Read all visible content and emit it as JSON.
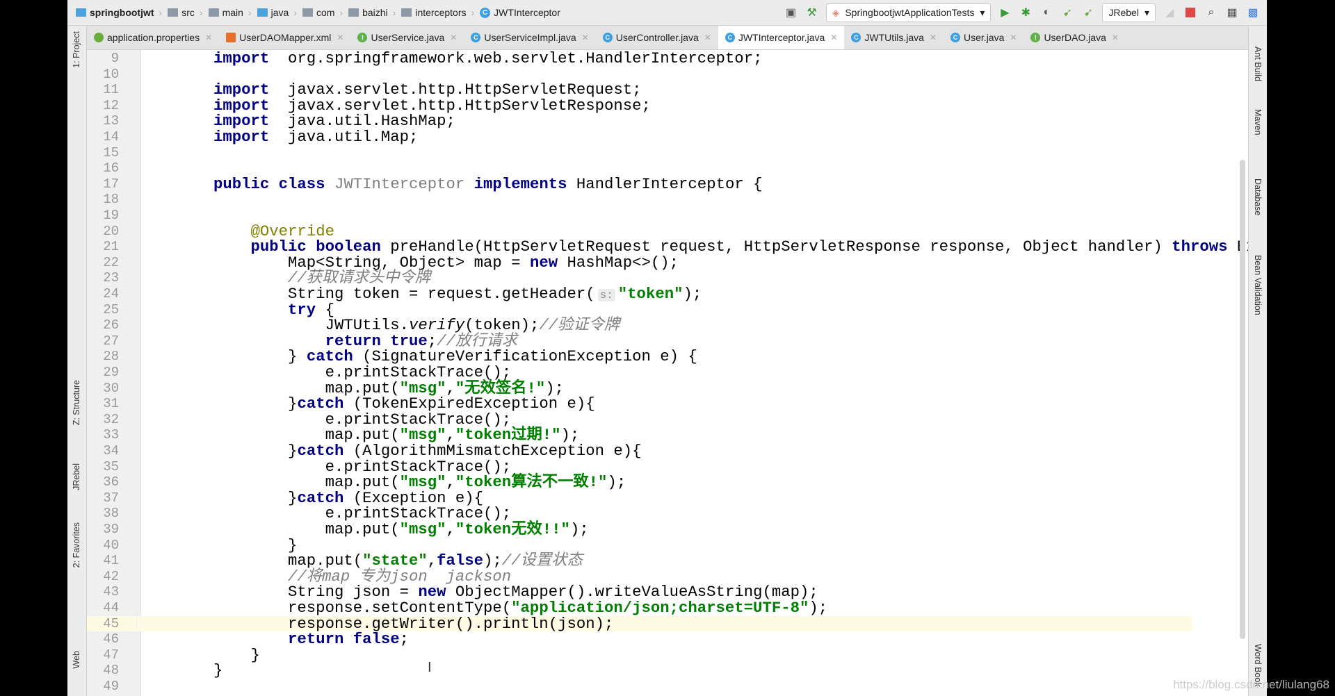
{
  "breadcrumb": [
    "springbootjwt",
    "src",
    "main",
    "java",
    "com",
    "baizhi",
    "interceptors",
    "JWTInterceptor"
  ],
  "toolbar": {
    "run_config": "SpringbootjwtApplicationTests",
    "jrebel": "JRebel"
  },
  "tabs": [
    {
      "label": "application.properties",
      "icon": "spring-leaf-icon",
      "color": "#6aab3c"
    },
    {
      "label": "UserDAOMapper.xml",
      "icon": "xml-file-icon",
      "color": "#e8702a"
    },
    {
      "label": "UserService.java",
      "icon": "interface-icon",
      "color": "#5fb14c"
    },
    {
      "label": "UserServiceImpl.java",
      "icon": "class-icon",
      "color": "#3d9fe0"
    },
    {
      "label": "UserController.java",
      "icon": "class-icon",
      "color": "#3d9fe0"
    },
    {
      "label": "JWTInterceptor.java",
      "icon": "class-icon",
      "color": "#3d9fe0",
      "active": true
    },
    {
      "label": "JWTUtils.java",
      "icon": "class-icon",
      "color": "#3d9fe0"
    },
    {
      "label": "User.java",
      "icon": "class-icon",
      "color": "#3d9fe0"
    },
    {
      "label": "UserDAO.java",
      "icon": "interface-icon",
      "color": "#5fb14c"
    }
  ],
  "left_tools": [
    "1: Project",
    "Z: Structure",
    "JRebel",
    "2: Favorites",
    "Web"
  ],
  "right_tools": [
    "Ant Build",
    "Maven",
    "Database",
    "Bean Validation",
    "Word Book"
  ],
  "current_line": 45,
  "code": [
    {
      "n": 9,
      "t": [
        [
          "kw",
          "import"
        ],
        [
          "",
          "  org.springframework.web.servlet.HandlerInterceptor;"
        ]
      ]
    },
    {
      "n": 10,
      "t": []
    },
    {
      "n": 11,
      "t": [
        [
          "kw",
          "import"
        ],
        [
          "",
          "  javax.servlet.http.HttpServletRequest;"
        ]
      ]
    },
    {
      "n": 12,
      "t": [
        [
          "kw",
          "import"
        ],
        [
          "",
          "  javax.servlet.http.HttpServletResponse;"
        ]
      ]
    },
    {
      "n": 13,
      "t": [
        [
          "kw",
          "import"
        ],
        [
          "",
          "  java.util.HashMap;"
        ]
      ]
    },
    {
      "n": 14,
      "t": [
        [
          "kw",
          "import"
        ],
        [
          "",
          "  java.util.Map;"
        ]
      ]
    },
    {
      "n": 15,
      "t": []
    },
    {
      "n": 16,
      "t": []
    },
    {
      "n": 17,
      "t": [
        [
          "kw",
          "public class "
        ],
        [
          "un",
          "JWTInterceptor"
        ],
        [
          "",
          " "
        ],
        [
          "kw",
          "implements"
        ],
        [
          "",
          " HandlerInterceptor {"
        ]
      ]
    },
    {
      "n": 18,
      "t": []
    },
    {
      "n": 19,
      "t": []
    },
    {
      "n": 20,
      "t": [
        [
          "",
          "    "
        ],
        [
          "ann",
          "@Override"
        ]
      ]
    },
    {
      "n": 21,
      "t": [
        [
          "",
          "    "
        ],
        [
          "kw",
          "public boolean"
        ],
        [
          "",
          " preHandle(HttpServletRequest request, HttpServletResponse response, Object handler) "
        ],
        [
          "kw",
          "throws"
        ],
        [
          "",
          " Exception {"
        ]
      ]
    },
    {
      "n": 22,
      "t": [
        [
          "",
          "        Map<String, Object> map = "
        ],
        [
          "kw",
          "new"
        ],
        [
          "",
          " HashMap<>();"
        ]
      ]
    },
    {
      "n": 23,
      "t": [
        [
          "",
          "        "
        ],
        [
          "cm",
          "//获取请求头中令牌"
        ]
      ]
    },
    {
      "n": 24,
      "t": [
        [
          "",
          "        String token = request.getHeader("
        ],
        [
          "hint",
          "s:"
        ],
        [
          "str",
          "\"token\""
        ],
        [
          "",
          ");"
        ]
      ]
    },
    {
      "n": 25,
      "t": [
        [
          "",
          "        "
        ],
        [
          "kw",
          "try"
        ],
        [
          "",
          " {"
        ]
      ]
    },
    {
      "n": 26,
      "t": [
        [
          "",
          "            JWTUtils."
        ],
        [
          "it",
          "verify"
        ],
        [
          "",
          "(token);"
        ],
        [
          "cm",
          "//验证令牌"
        ]
      ]
    },
    {
      "n": 27,
      "t": [
        [
          "",
          "            "
        ],
        [
          "kw",
          "return true"
        ],
        [
          "",
          ";"
        ],
        [
          "cm",
          "//放行请求"
        ]
      ]
    },
    {
      "n": 28,
      "t": [
        [
          "",
          "        } "
        ],
        [
          "kw",
          "catch"
        ],
        [
          "",
          " (SignatureVerificationException e) {"
        ]
      ]
    },
    {
      "n": 29,
      "t": [
        [
          "",
          "            e.printStackTrace();"
        ]
      ]
    },
    {
      "n": 30,
      "t": [
        [
          "",
          "            map.put("
        ],
        [
          "str",
          "\"msg\""
        ],
        [
          "",
          ","
        ],
        [
          "str",
          "\"无效签名!\""
        ],
        [
          "",
          ");"
        ]
      ]
    },
    {
      "n": 31,
      "t": [
        [
          "",
          "        }"
        ],
        [
          "kw",
          "catch"
        ],
        [
          "",
          " (TokenExpiredException e){"
        ]
      ]
    },
    {
      "n": 32,
      "t": [
        [
          "",
          "            e.printStackTrace();"
        ]
      ]
    },
    {
      "n": 33,
      "t": [
        [
          "",
          "            map.put("
        ],
        [
          "str",
          "\"msg\""
        ],
        [
          "",
          ","
        ],
        [
          "str",
          "\"token过期!\""
        ],
        [
          "",
          ");"
        ]
      ]
    },
    {
      "n": 34,
      "t": [
        [
          "",
          "        }"
        ],
        [
          "kw",
          "catch"
        ],
        [
          "",
          " (AlgorithmMismatchException e){"
        ]
      ]
    },
    {
      "n": 35,
      "t": [
        [
          "",
          "            e.printStackTrace();"
        ]
      ]
    },
    {
      "n": 36,
      "t": [
        [
          "",
          "            map.put("
        ],
        [
          "str",
          "\"msg\""
        ],
        [
          "",
          ","
        ],
        [
          "str",
          "\"token算法不一致!\""
        ],
        [
          "",
          ");"
        ]
      ]
    },
    {
      "n": 37,
      "t": [
        [
          "",
          "        }"
        ],
        [
          "kw",
          "catch"
        ],
        [
          "",
          " (Exception e){"
        ]
      ]
    },
    {
      "n": 38,
      "t": [
        [
          "",
          "            e.printStackTrace();"
        ]
      ]
    },
    {
      "n": 39,
      "t": [
        [
          "",
          "            map.put("
        ],
        [
          "str",
          "\"msg\""
        ],
        [
          "",
          ","
        ],
        [
          "str",
          "\"token无效!!\""
        ],
        [
          "",
          ");"
        ]
      ]
    },
    {
      "n": 40,
      "t": [
        [
          "",
          "        }"
        ]
      ]
    },
    {
      "n": 41,
      "t": [
        [
          "",
          "        map.put("
        ],
        [
          "str",
          "\"state\""
        ],
        [
          "",
          ","
        ],
        [
          "kw",
          "false"
        ],
        [
          "",
          ");"
        ],
        [
          "cm",
          "//设置状态"
        ]
      ]
    },
    {
      "n": 42,
      "t": [
        [
          "",
          "        "
        ],
        [
          "cm",
          "//将map 专为json  jackson"
        ]
      ]
    },
    {
      "n": 43,
      "t": [
        [
          "",
          "        String json = "
        ],
        [
          "kw",
          "new"
        ],
        [
          "",
          " ObjectMapper().writeValueAsString(map);"
        ]
      ]
    },
    {
      "n": 44,
      "t": [
        [
          "",
          "        response.setContentType("
        ],
        [
          "str",
          "\"application/json;charset=UTF-8\""
        ],
        [
          "",
          ");"
        ]
      ]
    },
    {
      "n": 45,
      "t": [
        [
          "",
          "        response.getWriter().println(json);"
        ]
      ]
    },
    {
      "n": 46,
      "t": [
        [
          "",
          "        "
        ],
        [
          "kw",
          "return false"
        ],
        [
          "",
          ";"
        ]
      ]
    },
    {
      "n": 47,
      "t": [
        [
          "",
          "    }"
        ]
      ]
    },
    {
      "n": 48,
      "t": [
        [
          "",
          "}"
        ]
      ]
    },
    {
      "n": 49,
      "t": []
    }
  ],
  "watermark": "https://blog.csdn.net/liulang68"
}
